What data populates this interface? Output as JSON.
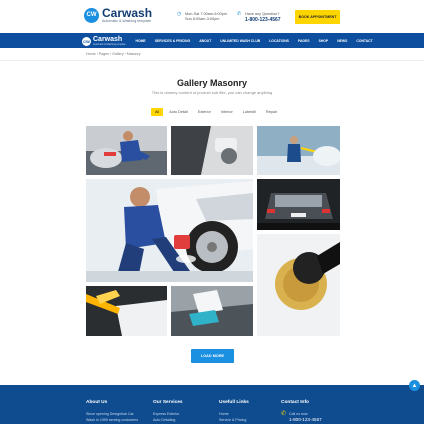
{
  "header": {
    "logo_title": "Carwash",
    "logo_sub": "Automatic & Washing template",
    "hours_line1": "Mon-Sat 7:00am-6:00pm",
    "hours_line2": "Sun 8:00am-3:00pm",
    "question_label": "Have any Question?",
    "phone": "1-800-123-4567",
    "appointment_label": "BOOK APPOINTMENT"
  },
  "nav": {
    "logo": "Carwash",
    "logo_sub": "Automatic & Washing template",
    "items": [
      "HOME",
      "SERVICES & PRICING",
      "ABOUT",
      "UNLIMITED WASH CLUB",
      "LOCATIONS",
      "PAGES",
      "SHOP",
      "NEWS",
      "CONTACT"
    ]
  },
  "breadcrumb": "Home  ›  Pages  ›  Gallery  ›  Masonry",
  "page": {
    "title": "Gallery Masonry",
    "subtitle": "This is dummy content of product sub title, you can change anything"
  },
  "filters": [
    "All",
    "Auto Detail",
    "Exterior",
    "Interior",
    "Lubestil",
    "Repair"
  ],
  "active_filter": "All",
  "load_more_label": "LOAD MORE",
  "footer": {
    "about_title": "About Us",
    "about_text1": "Since opening Designhub Car",
    "about_text2": "Wash in 1990 serving customers",
    "services_title": "Our Services",
    "services": [
      "Express Exterior",
      "Auto Detailing"
    ],
    "links_title": "Usefull Links",
    "links": [
      "Home",
      "Service & Pricing"
    ],
    "contact_title": "Contact Info",
    "contact_label": "Call us now",
    "contact_phone": "1-800-123-4567"
  },
  "colors": {
    "brand_blue": "#0d4f9e",
    "accent_yellow": "#ffd500",
    "button_blue": "#1b8fe0"
  }
}
